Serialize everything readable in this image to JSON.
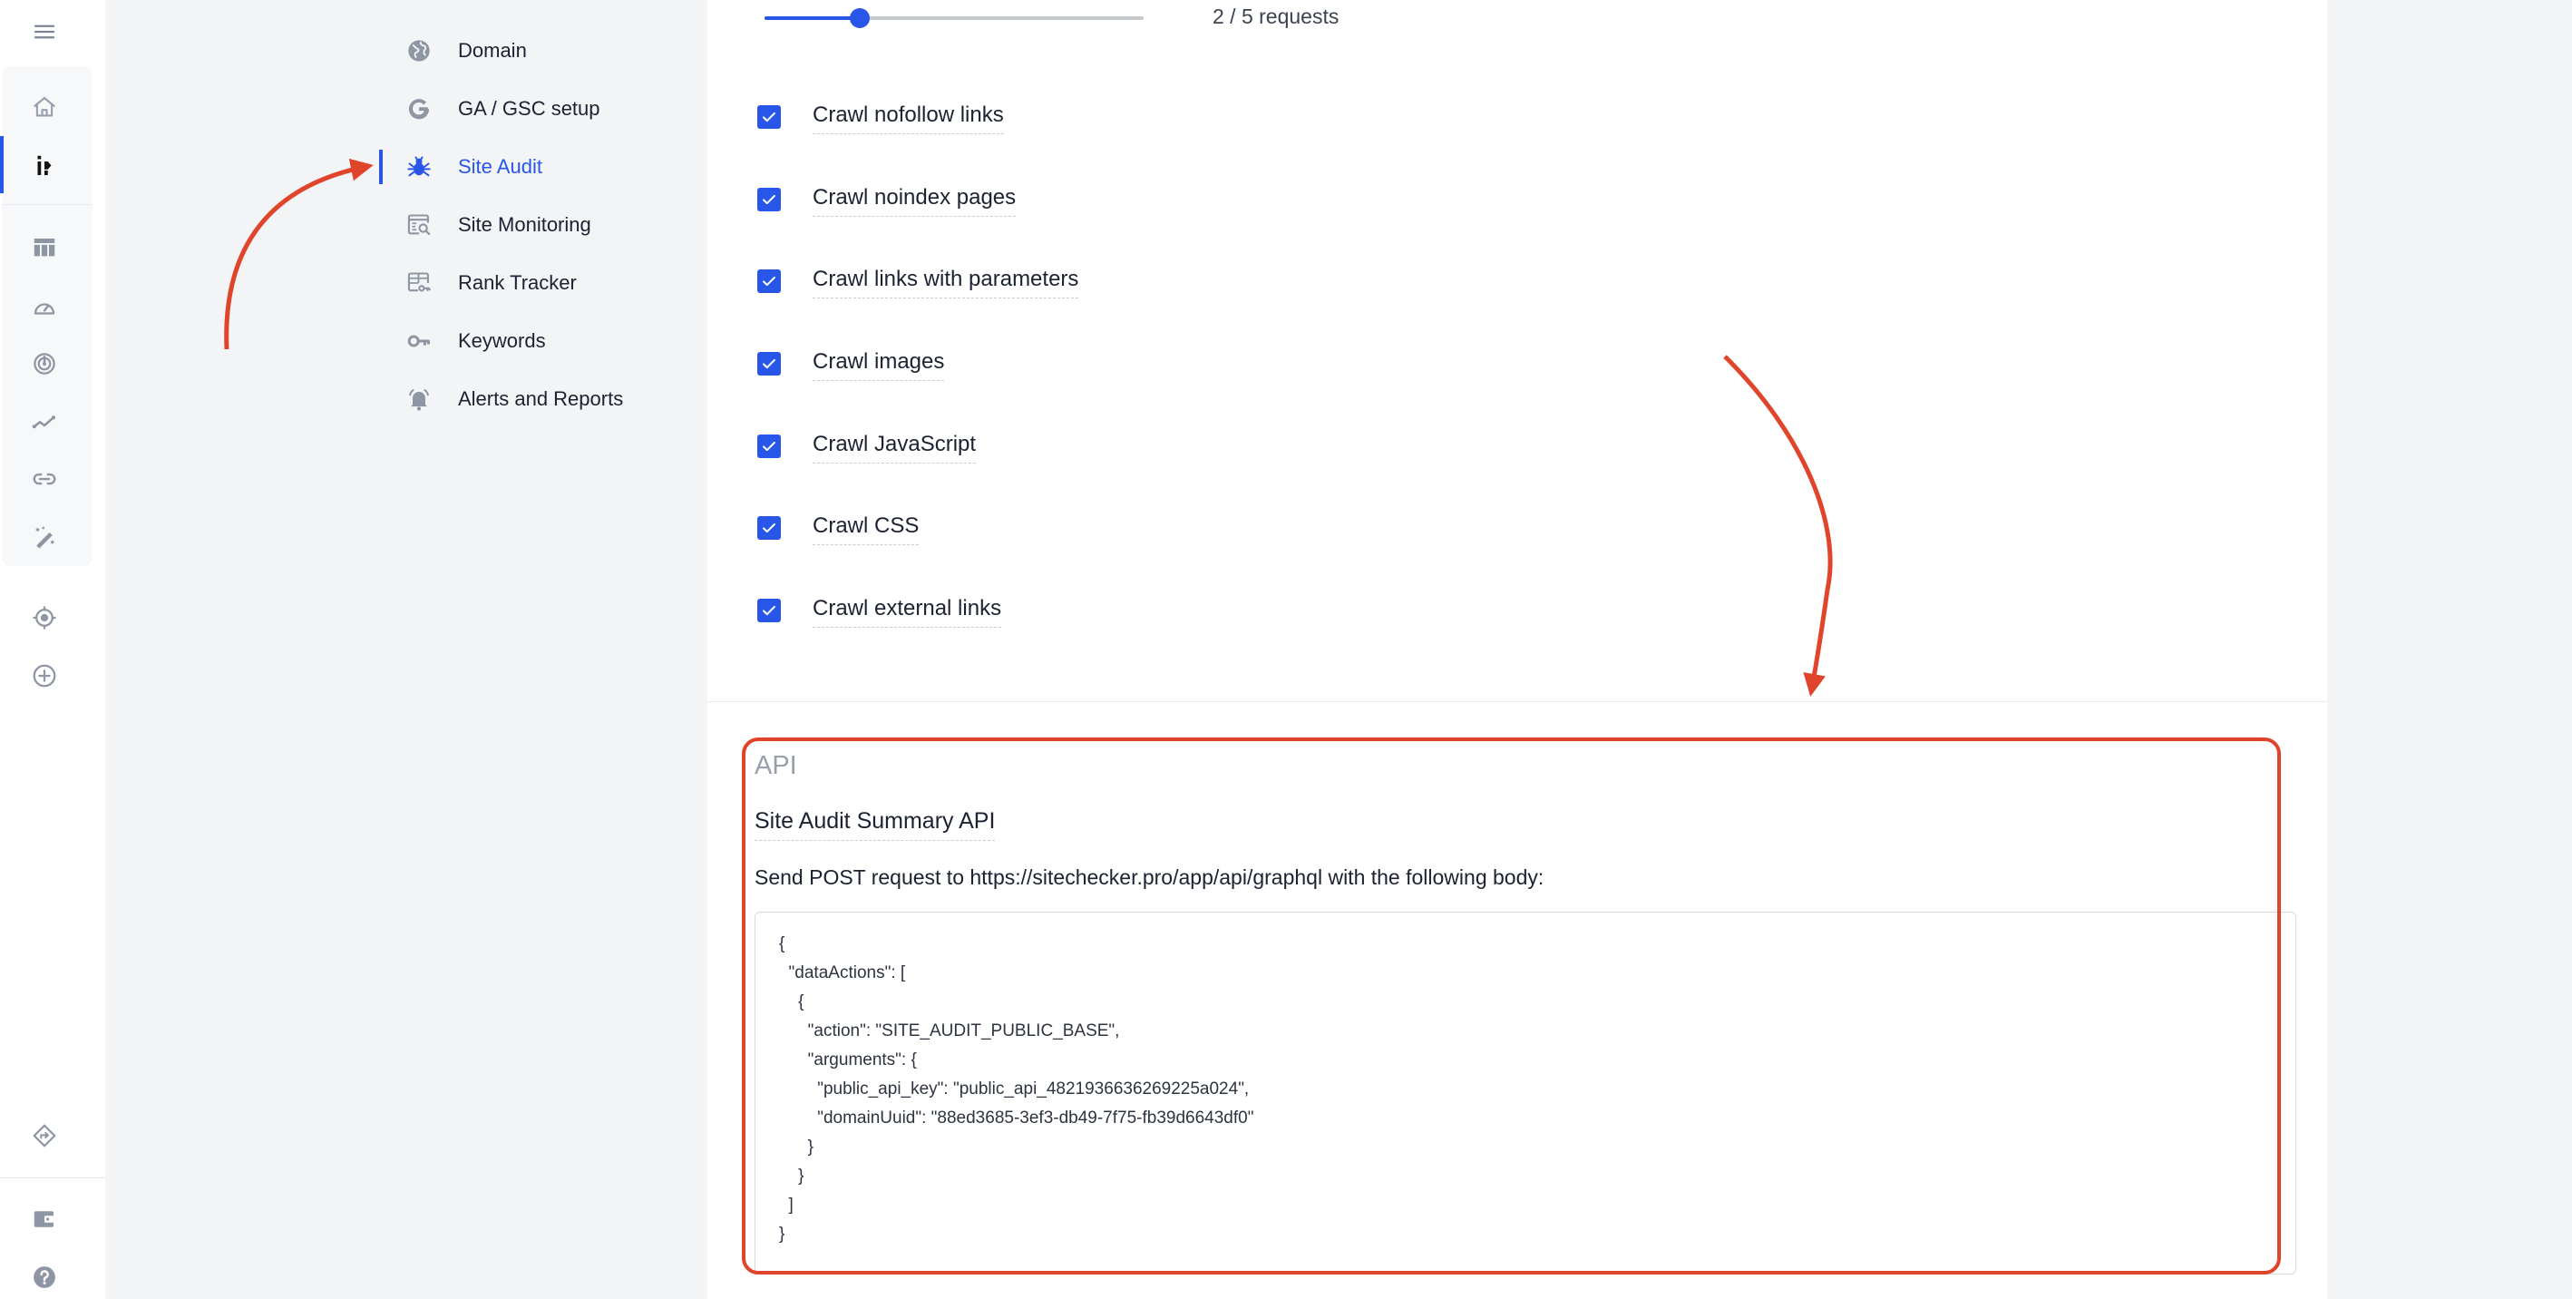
{
  "sidebar": {
    "top": [
      {
        "icon": "menu-icon"
      }
    ],
    "group": [
      {
        "icon": "home-icon"
      },
      {
        "icon": "project-logo-icon",
        "active": true
      },
      {
        "icon": "table-icon"
      },
      {
        "icon": "speedometer-icon"
      },
      {
        "icon": "radar-icon"
      },
      {
        "icon": "trend-line-icon"
      },
      {
        "icon": "link-icon"
      },
      {
        "icon": "magic-wand-icon"
      }
    ],
    "extra": [
      {
        "icon": "target-icon"
      },
      {
        "icon": "add-circle-icon"
      }
    ],
    "bottom": [
      {
        "icon": "directions-icon"
      },
      {
        "icon": "wallet-icon"
      },
      {
        "icon": "help-icon"
      }
    ]
  },
  "nav": {
    "items": [
      {
        "label": "Domain",
        "icon": "globe-icon",
        "active": false
      },
      {
        "label": "GA / GSC setup",
        "icon": "google-icon",
        "active": false
      },
      {
        "label": "Site Audit",
        "icon": "bug-icon",
        "active": true
      },
      {
        "label": "Site Monitoring",
        "icon": "monitor-search-icon",
        "active": false
      },
      {
        "label": "Rank Tracker",
        "icon": "rank-tracker-icon",
        "active": false
      },
      {
        "label": "Keywords",
        "icon": "key-icon",
        "active": false
      },
      {
        "label": "Alerts and Reports",
        "icon": "bell-icon",
        "active": false
      }
    ]
  },
  "crawl": {
    "slider": {
      "value": 2,
      "min": 1,
      "max": 5,
      "label": "2 / 5 requests"
    },
    "options": [
      {
        "label": "Crawl nofollow links",
        "checked": true
      },
      {
        "label": "Crawl noindex pages",
        "checked": true
      },
      {
        "label": "Crawl links with parameters",
        "checked": true
      },
      {
        "label": "Crawl images",
        "checked": true
      },
      {
        "label": "Crawl JavaScript",
        "checked": true
      },
      {
        "label": "Crawl CSS",
        "checked": true
      },
      {
        "label": "Crawl external links",
        "checked": true
      }
    ]
  },
  "api": {
    "title": "API",
    "subtitle": "Site Audit Summary API",
    "description": "Send POST request to https://sitechecker.pro/app/api/graphql with the following body:",
    "code_lines": [
      "{",
      "  \"dataActions\": [",
      "    {",
      "      \"action\": \"SITE_AUDIT_PUBLIC_BASE\",",
      "      \"arguments\": {",
      "        \"public_api_key\": \"public_api_4821936636269225a024\",",
      "        \"domainUuid\": \"88ed3685-3ef3-db49-7f75-fb39d6643df0\"",
      "      }",
      "    }",
      "  ]",
      "}"
    ]
  },
  "colors": {
    "accent": "#2756e8",
    "annotation": "#e0442b",
    "icon_grey": "#8e96a3",
    "background": "#f3f4f6"
  }
}
